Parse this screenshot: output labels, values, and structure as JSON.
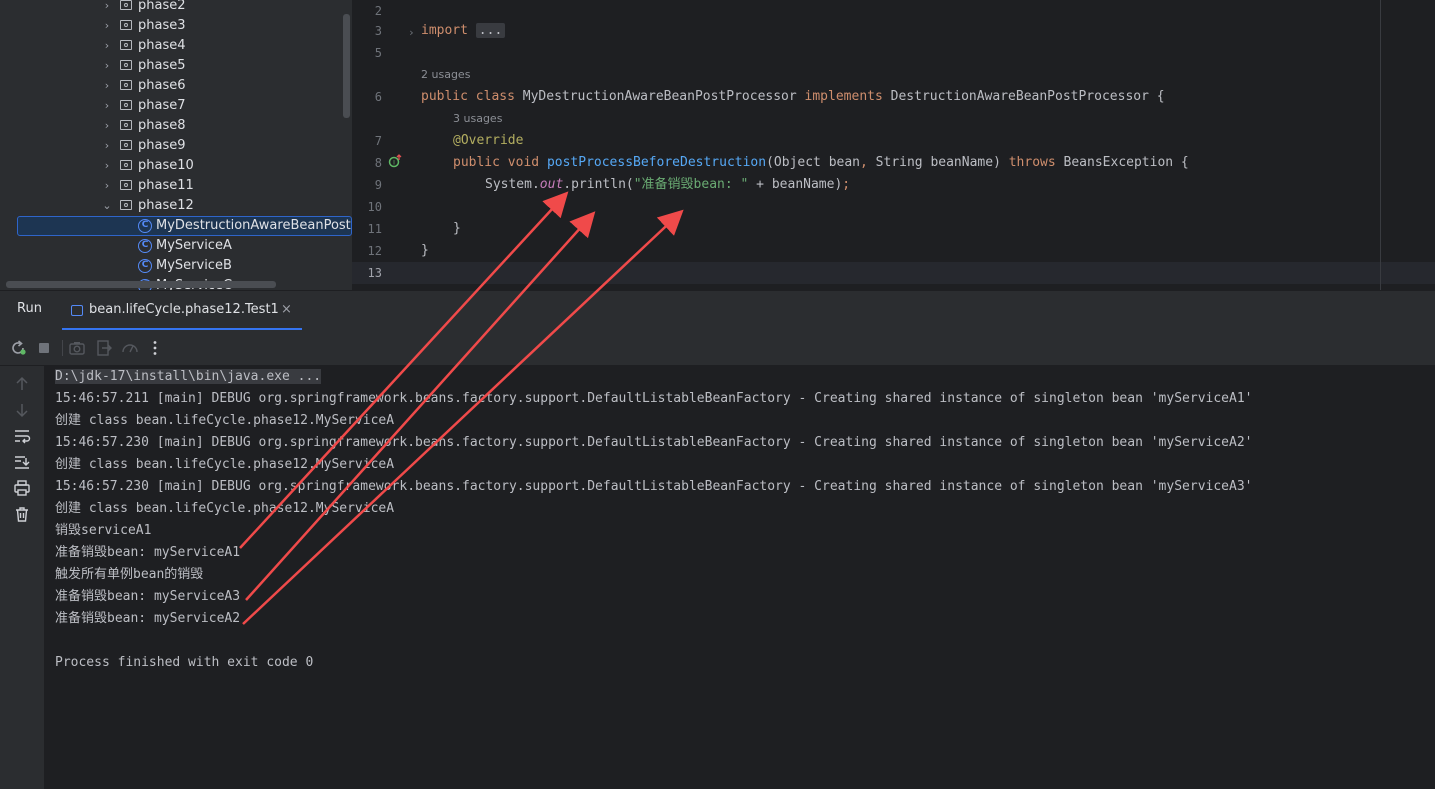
{
  "project_tree": {
    "items": [
      {
        "label": "phase2",
        "type": "package"
      },
      {
        "label": "phase3",
        "type": "package"
      },
      {
        "label": "phase4",
        "type": "package"
      },
      {
        "label": "phase5",
        "type": "package"
      },
      {
        "label": "phase6",
        "type": "package"
      },
      {
        "label": "phase7",
        "type": "package"
      },
      {
        "label": "phase8",
        "type": "package"
      },
      {
        "label": "phase9",
        "type": "package"
      },
      {
        "label": "phase10",
        "type": "package"
      },
      {
        "label": "phase11",
        "type": "package"
      },
      {
        "label": "phase12",
        "type": "package",
        "expanded": true
      },
      {
        "label": "MyDestructionAwareBeanPostP",
        "type": "class",
        "selected": true
      },
      {
        "label": "MyServiceA",
        "type": "class"
      },
      {
        "label": "MyServiceB",
        "type": "class"
      },
      {
        "label": "MyServiceC",
        "type": "class"
      }
    ],
    "class_icon_glyph": "C"
  },
  "editor": {
    "line_numbers": [
      "2",
      "3",
      "5",
      "6",
      "7",
      "8",
      "9",
      "10",
      "11",
      "12",
      "13"
    ],
    "current_line": "13",
    "hints": {
      "class_usages": "2 usages",
      "method_usages": "3 usages"
    },
    "code": {
      "import_kw": "import",
      "import_fold": "...",
      "l6_public": "public",
      "l6_class": "class",
      "l6_name": "MyDestructionAwareBeanPostProcessor",
      "l6_implements": "implements",
      "l6_iface": "DestructionAwareBeanPostProcessor",
      "l6_brace": "{",
      "l7_annotation": "@Override",
      "l8_public": "public",
      "l8_void": "void",
      "l8_method": "postProcessBeforeDestruction",
      "l8_params_open": "(Object bean",
      "l8_comma": ",",
      "l8_param2": " String beanName) ",
      "l8_throws": "throws",
      "l8_exc": " BeansException {",
      "l9_system": "System.",
      "l9_out": "out",
      "l9_println": ".println(",
      "l9_string": "\"准备销毁bean: \"",
      "l9_rest": " + beanName)",
      "l9_semicolon": ";",
      "l11_brace": "}",
      "l12_brace": "}"
    }
  },
  "run_window": {
    "title": "Run",
    "tab_label": "bean.lifeCycle.phase12.Test1",
    "tab_close": "×"
  },
  "toolbar_icons": [
    "rerun-icon",
    "stop-icon",
    "camera-icon",
    "exit-icon",
    "profiler-icon",
    "more-icon"
  ],
  "side_icons": [
    "arrow-up-icon",
    "arrow-down-icon",
    "soft-wrap-icon",
    "scroll-to-end-icon",
    "print-icon",
    "trash-icon"
  ],
  "console": {
    "lines": [
      "D:\\jdk-17\\install\\bin\\java.exe ...",
      "15:46:57.211 [main] DEBUG org.springframework.beans.factory.support.DefaultListableBeanFactory - Creating shared instance of singleton bean 'myServiceA1'",
      "创建 class bean.lifeCycle.phase12.MyServiceA",
      "15:46:57.230 [main] DEBUG org.springframework.beans.factory.support.DefaultListableBeanFactory - Creating shared instance of singleton bean 'myServiceA2'",
      "创建 class bean.lifeCycle.phase12.MyServiceA",
      "15:46:57.230 [main] DEBUG org.springframework.beans.factory.support.DefaultListableBeanFactory - Creating shared instance of singleton bean 'myServiceA3'",
      "创建 class bean.lifeCycle.phase12.MyServiceA",
      "销毁serviceA1",
      "准备销毁bean: myServiceA1",
      "触发所有单例bean的销毁",
      "准备销毁bean: myServiceA3",
      "准备销毁bean: myServiceA2",
      "",
      "Process finished with exit code 0"
    ]
  },
  "colors": {
    "annotation_arrow": "#f04a4a",
    "selection_bg": "#1d3552",
    "tab_underline": "#3574f0"
  }
}
